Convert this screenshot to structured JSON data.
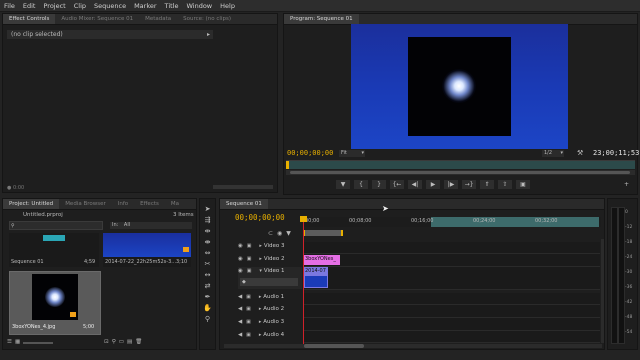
{
  "menu": [
    "File",
    "Edit",
    "Project",
    "Clip",
    "Sequence",
    "Marker",
    "Title",
    "Window",
    "Help"
  ],
  "source_panel": {
    "tabs": [
      "Effect Controls",
      "Audio Mixer: Sequence 01",
      "Metadata",
      "Source: (no clips)"
    ],
    "no_clip_text": "(no clip selected)",
    "time": "0:00"
  },
  "program": {
    "tab": "Program: Sequence 01",
    "timecode_left": "00;00;00;00",
    "fit": "Fit",
    "resolution": "1/2",
    "timecode_right": "23;00;11;53"
  },
  "project": {
    "tabs": [
      "Project: Untitled",
      "Media Browser",
      "Info",
      "Effects",
      "Ma"
    ],
    "file": "Untitled.prproj",
    "items_count": "3 Items",
    "in_label": "In:",
    "in_value": "All",
    "items": [
      {
        "name": "Sequence 01",
        "duration": "4;59"
      },
      {
        "name": "2014-07-22_22h25m52s-3...",
        "duration": "3;10"
      },
      {
        "name": "3boxYONes_4.jpg",
        "duration": "5;00"
      }
    ]
  },
  "timeline": {
    "tab": "Sequence 01",
    "timecode": "00;00;00;00",
    "ruler": [
      "00;00",
      "00;08;00",
      "00;16;00",
      "00;24;00",
      "00;32;00"
    ],
    "video_tracks": [
      {
        "name": "Video 3",
        "clip": ""
      },
      {
        "name": "Video 2",
        "clip": "3boxYONes_"
      },
      {
        "name": "Video 1",
        "clip": "2014-07"
      }
    ],
    "audio_tracks": [
      "Audio 1",
      "Audio 2",
      "Audio 3",
      "Audio 4"
    ]
  },
  "meter_labels": [
    "0",
    "-12",
    "-18",
    "-24",
    "-30",
    "-36",
    "-42",
    "-48",
    "-54"
  ]
}
